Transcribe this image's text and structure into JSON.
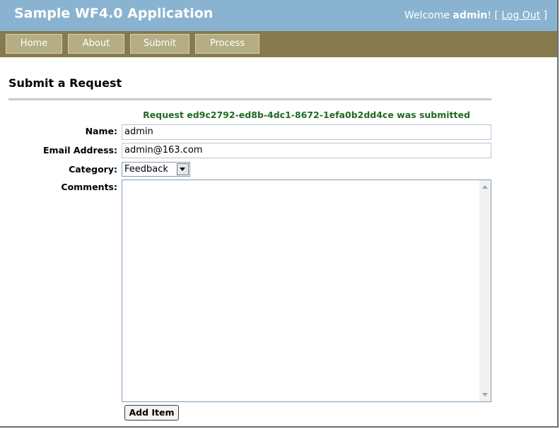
{
  "header": {
    "title": "Sample WF4.0 Application",
    "welcome_prefix": "Welcome",
    "user": "admin",
    "after_user": "! [",
    "logout_label": "Log Out",
    "close_bracket": "]"
  },
  "menu": {
    "items": [
      {
        "label": "Home"
      },
      {
        "label": "About"
      },
      {
        "label": "Submit"
      },
      {
        "label": "Process"
      }
    ]
  },
  "page": {
    "title": "Submit a Request",
    "message": "Request ed9c2792-ed8b-4dc1-8672-1efa0b2dd4ce was submitted"
  },
  "form": {
    "name_label": "Name:",
    "name_value": "admin",
    "email_label": "Email Address:",
    "email_value": "admin@163.com",
    "category_label": "Category:",
    "category_value": "Feedback",
    "comments_label": "Comments:",
    "comments_value": "",
    "submit_label": "Add Item"
  },
  "colors": {
    "header_bg": "#8ab3d1",
    "menu_bg": "#877a4f",
    "menu_item_bg": "#b5ad84",
    "message": "#1f6b1f"
  }
}
